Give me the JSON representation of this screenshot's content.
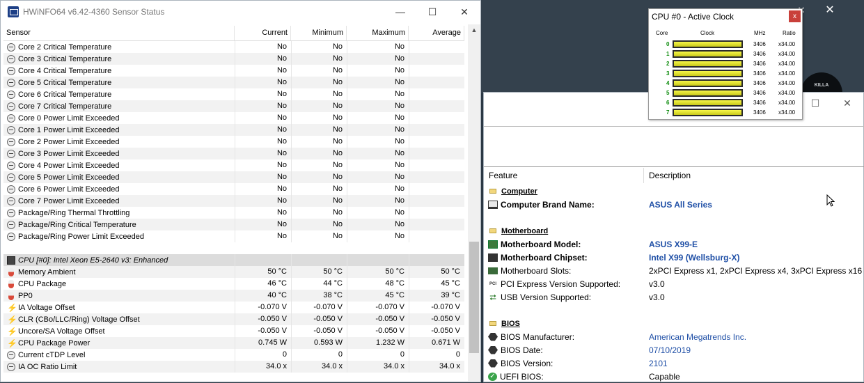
{
  "background": {
    "logo_text": "KILLA"
  },
  "sensor": {
    "title": "HWiNFO64 v6.42-4360 Sensor Status",
    "columns": [
      "Sensor",
      "Current",
      "Minimum",
      "Maximum",
      "Average"
    ],
    "rows": [
      {
        "icon": "circle-icon",
        "name": "Core 2 Critical Temperature",
        "cur": "No",
        "min": "No",
        "max": "No",
        "avg": ""
      },
      {
        "icon": "circle-icon",
        "name": "Core 3 Critical Temperature",
        "cur": "No",
        "min": "No",
        "max": "No",
        "avg": ""
      },
      {
        "icon": "circle-icon",
        "name": "Core 4 Critical Temperature",
        "cur": "No",
        "min": "No",
        "max": "No",
        "avg": ""
      },
      {
        "icon": "circle-icon",
        "name": "Core 5 Critical Temperature",
        "cur": "No",
        "min": "No",
        "max": "No",
        "avg": ""
      },
      {
        "icon": "circle-icon",
        "name": "Core 6 Critical Temperature",
        "cur": "No",
        "min": "No",
        "max": "No",
        "avg": ""
      },
      {
        "icon": "circle-icon",
        "name": "Core 7 Critical Temperature",
        "cur": "No",
        "min": "No",
        "max": "No",
        "avg": ""
      },
      {
        "icon": "circle-icon",
        "name": "Core 0 Power Limit Exceeded",
        "cur": "No",
        "min": "No",
        "max": "No",
        "avg": ""
      },
      {
        "icon": "circle-icon",
        "name": "Core 1 Power Limit Exceeded",
        "cur": "No",
        "min": "No",
        "max": "No",
        "avg": ""
      },
      {
        "icon": "circle-icon",
        "name": "Core 2 Power Limit Exceeded",
        "cur": "No",
        "min": "No",
        "max": "No",
        "avg": ""
      },
      {
        "icon": "circle-icon",
        "name": "Core 3 Power Limit Exceeded",
        "cur": "No",
        "min": "No",
        "max": "No",
        "avg": ""
      },
      {
        "icon": "circle-icon",
        "name": "Core 4 Power Limit Exceeded",
        "cur": "No",
        "min": "No",
        "max": "No",
        "avg": ""
      },
      {
        "icon": "circle-icon",
        "name": "Core 5 Power Limit Exceeded",
        "cur": "No",
        "min": "No",
        "max": "No",
        "avg": ""
      },
      {
        "icon": "circle-icon",
        "name": "Core 6 Power Limit Exceeded",
        "cur": "No",
        "min": "No",
        "max": "No",
        "avg": ""
      },
      {
        "icon": "circle-icon",
        "name": "Core 7 Power Limit Exceeded",
        "cur": "No",
        "min": "No",
        "max": "No",
        "avg": ""
      },
      {
        "icon": "circle-icon",
        "name": "Package/Ring Thermal Throttling",
        "cur": "No",
        "min": "No",
        "max": "No",
        "avg": ""
      },
      {
        "icon": "circle-icon",
        "name": "Package/Ring Critical Temperature",
        "cur": "No",
        "min": "No",
        "max": "No",
        "avg": ""
      },
      {
        "icon": "circle-icon",
        "name": "Package/Ring Power Limit Exceeded",
        "cur": "No",
        "min": "No",
        "max": "No",
        "avg": ""
      },
      {
        "type": "spacer"
      },
      {
        "type": "group",
        "icon": "chip-icon",
        "name": "CPU [#0]: Intel Xeon E5-2640 v3: Enhanced"
      },
      {
        "icon": "thermometer-icon",
        "name": "Memory Ambient",
        "cur": "50 °C",
        "min": "50 °C",
        "max": "50 °C",
        "avg": "50 °C"
      },
      {
        "icon": "thermometer-icon",
        "name": "CPU Package",
        "cur": "46 °C",
        "min": "44 °C",
        "max": "48 °C",
        "avg": "45 °C"
      },
      {
        "icon": "thermometer-icon",
        "name": "PP0",
        "cur": "40 °C",
        "min": "38 °C",
        "max": "45 °C",
        "avg": "39 °C"
      },
      {
        "icon": "lightning-icon",
        "name": "IA Voltage Offset",
        "cur": "-0.070 V",
        "min": "-0.070 V",
        "max": "-0.070 V",
        "avg": "-0.070 V"
      },
      {
        "icon": "lightning-icon",
        "name": "CLR (CBo/LLC/Ring) Voltage Offset",
        "cur": "-0.050 V",
        "min": "-0.050 V",
        "max": "-0.050 V",
        "avg": "-0.050 V"
      },
      {
        "icon": "lightning-icon",
        "name": "Uncore/SA Voltage Offset",
        "cur": "-0.050 V",
        "min": "-0.050 V",
        "max": "-0.050 V",
        "avg": "-0.050 V"
      },
      {
        "icon": "lightning-icon",
        "name": "CPU Package Power",
        "cur": "0.745 W",
        "min": "0.593 W",
        "max": "1.232 W",
        "avg": "0.671 W"
      },
      {
        "icon": "circle-icon",
        "name": "Current cTDP Level",
        "cur": "0",
        "min": "0",
        "max": "0",
        "avg": "0"
      },
      {
        "icon": "circle-icon",
        "name": "IA OC Ratio Limit",
        "cur": "34.0 x",
        "min": "34.0 x",
        "max": "34.0 x",
        "avg": "34.0 x"
      }
    ]
  },
  "summary": {
    "columns": [
      "Feature",
      "Description"
    ],
    "rows": [
      {
        "type": "section",
        "label": "Computer"
      },
      {
        "icon": "monitor-icon",
        "feature": "Computer Brand Name:",
        "desc": "ASUS All Series",
        "style": "bold-blue"
      },
      {
        "type": "blank"
      },
      {
        "type": "section",
        "label": "Motherboard"
      },
      {
        "icon": "motherboard-icon",
        "feature": "Motherboard Model:",
        "desc": "ASUS X99-E",
        "style": "bold-blue"
      },
      {
        "icon": "chipset-icon",
        "feature": "Motherboard Chipset:",
        "desc": "Intel X99 (Wellsburg-X)",
        "style": "bold-blue"
      },
      {
        "icon": "slot-icon",
        "feature": "Motherboard Slots:",
        "desc": "2xPCI Express x1, 2xPCI Express x4, 3xPCI Express x16",
        "style": "plain"
      },
      {
        "icon": "pci-express-icon",
        "feature": "PCI Express Version Supported:",
        "desc": "v3.0",
        "style": "plain"
      },
      {
        "icon": "usb-icon",
        "feature": "USB Version Supported:",
        "desc": "v3.0",
        "style": "plain"
      },
      {
        "type": "blank"
      },
      {
        "type": "section",
        "label": "BIOS"
      },
      {
        "icon": "bios-chip-icon",
        "feature": "BIOS Manufacturer:",
        "desc": "American Megatrends Inc.",
        "style": "blue"
      },
      {
        "icon": "bios-chip-icon",
        "feature": "BIOS Date:",
        "desc": "07/10/2019",
        "style": "blue"
      },
      {
        "icon": "bios-chip-icon",
        "feature": "BIOS Version:",
        "desc": "2101",
        "style": "blue"
      },
      {
        "icon": "uefi-check-icon",
        "feature": "UEFI BIOS:",
        "desc": "Capable",
        "style": "plain"
      }
    ]
  },
  "clock": {
    "title": "CPU #0 - Active Clock",
    "close_label": "x",
    "headers": {
      "core": "Core",
      "clock": "Clock",
      "mhz": "MHz",
      "ratio": "Ratio"
    },
    "cores": [
      {
        "id": "0",
        "mhz": "3406",
        "ratio": "x34.00",
        "fill": 1.0
      },
      {
        "id": "1",
        "mhz": "3406",
        "ratio": "x34.00",
        "fill": 1.0
      },
      {
        "id": "2",
        "mhz": "3406",
        "ratio": "x34.00",
        "fill": 1.0
      },
      {
        "id": "3",
        "mhz": "3406",
        "ratio": "x34.00",
        "fill": 1.0
      },
      {
        "id": "4",
        "mhz": "3406",
        "ratio": "x34.00",
        "fill": 1.0
      },
      {
        "id": "5",
        "mhz": "3406",
        "ratio": "x34.00",
        "fill": 1.0
      },
      {
        "id": "6",
        "mhz": "3406",
        "ratio": "x34.00",
        "fill": 1.0
      },
      {
        "id": "7",
        "mhz": "3406",
        "ratio": "x34.00",
        "fill": 1.0
      }
    ]
  },
  "window_controls": {
    "minimize": "—",
    "maximize": "☐",
    "close": "✕"
  }
}
